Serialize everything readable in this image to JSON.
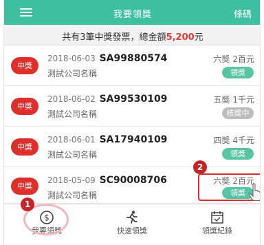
{
  "header": {
    "title": "我要領獎",
    "barcode_label": "條碼",
    "menu_icon": "hamburger-menu-icon",
    "bg_color": "#3ebf9f"
  },
  "summary": {
    "prefix": "共有3筆中獎發票，總金額",
    "amount": "5,200",
    "suffix": "元"
  },
  "invoices": [
    {
      "badge": "中獎",
      "date": "2018-06-03",
      "number": "SA99880574",
      "company": "測試公司名稱",
      "prize": "六獎 2百元",
      "action": "領獎",
      "state": "active"
    },
    {
      "badge": "中獎",
      "date": "2018-06-02",
      "number": "SA99530109",
      "company": "測試公司名稱",
      "prize": "五獎 1千元",
      "action": "核獎中",
      "state": "disabled"
    },
    {
      "badge": "中獎",
      "date": "2018-06-01",
      "number": "SA17940109",
      "company": "測試公司名稱",
      "prize": "四獎 4千元",
      "action": "領獎",
      "state": "active"
    },
    {
      "badge": "中獎",
      "date": "2018-05-09",
      "number": "SC90008706",
      "company": "測試公司名稱",
      "prize": "六獎 2百元",
      "action": "領獎",
      "state": "active"
    }
  ],
  "annotations": {
    "step1": "1",
    "step2": "2"
  },
  "bottom_nav": [
    {
      "label": "我要領獎",
      "icon": "dollar-circle-icon"
    },
    {
      "label": "快速領獎",
      "icon": "running-person-icon"
    },
    {
      "label": "領獎紀錄",
      "icon": "calendar-check-icon"
    }
  ],
  "colors": {
    "accent": "#3ebf9f",
    "badge": "#df2f2b",
    "amount": "#e53935",
    "button": "#57c4a4",
    "button_disabled": "#bdbdbd",
    "annotation": "#c62424"
  }
}
